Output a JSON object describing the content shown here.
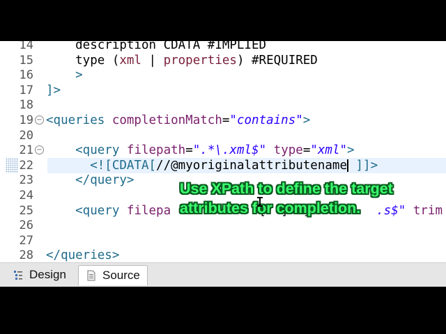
{
  "editor": {
    "lines": [
      {
        "num": "14",
        "parts": [
          [
            "plain",
            "    description CDATA #IMPLIED"
          ]
        ]
      },
      {
        "num": "15",
        "parts": [
          [
            "plain",
            "    type ("
          ],
          [
            "kw",
            "xml"
          ],
          [
            "plain",
            " | "
          ],
          [
            "kw",
            "properties"
          ],
          [
            "plain",
            ") #REQUIRED"
          ]
        ]
      },
      {
        "num": "16",
        "parts": [
          [
            "tag",
            "    >"
          ]
        ]
      },
      {
        "num": "17",
        "parts": [
          [
            "tag",
            "]>"
          ]
        ]
      },
      {
        "num": "18",
        "parts": []
      },
      {
        "num": "19",
        "fold": true,
        "parts": [
          [
            "tag",
            "<queries "
          ],
          [
            "attr",
            "completionMatch"
          ],
          [
            "plain",
            "="
          ],
          [
            "str",
            "\"contains\""
          ],
          [
            "tag",
            ">"
          ]
        ]
      },
      {
        "num": "20",
        "parts": []
      },
      {
        "num": "21",
        "fold": true,
        "parts": [
          [
            "tag",
            "    <query "
          ],
          [
            "attr",
            "filepath"
          ],
          [
            "plain",
            "="
          ],
          [
            "str",
            "\".*\\.xml$\""
          ],
          [
            "plain",
            " "
          ],
          [
            "attr",
            "type"
          ],
          [
            "plain",
            "="
          ],
          [
            "str",
            "\"xml\""
          ],
          [
            "tag",
            ">"
          ]
        ]
      },
      {
        "num": "22",
        "current": true,
        "cursor_after": 1,
        "parts": [
          [
            "tag",
            "      <![CDATA["
          ],
          [
            "plain",
            "//@myoriginalattributename"
          ],
          [
            "tag",
            " ]]>"
          ]
        ]
      },
      {
        "num": "23",
        "parts": [
          [
            "tag",
            "    </query>"
          ]
        ]
      },
      {
        "num": "24",
        "parts": []
      },
      {
        "num": "25",
        "parts": [
          [
            "tag",
            "    <query "
          ],
          [
            "attr",
            "filepa"
          ],
          [
            "plain",
            "            [  ]  ]         "
          ],
          [
            "str",
            ".s$\""
          ],
          [
            "plain",
            " "
          ],
          [
            "attr",
            "trim"
          ]
        ]
      },
      {
        "num": "26",
        "parts": []
      },
      {
        "num": "27",
        "parts": []
      },
      {
        "num": "28",
        "parts": [
          [
            "tag",
            "</queries>"
          ]
        ]
      }
    ]
  },
  "tabs": [
    {
      "label": "Design",
      "icon": "design-icon",
      "active": false
    },
    {
      "label": "Source",
      "icon": "source-icon",
      "active": true
    }
  ],
  "overlay": {
    "line1": "Use XPath to define the target",
    "line2": "attributes for completion."
  }
}
